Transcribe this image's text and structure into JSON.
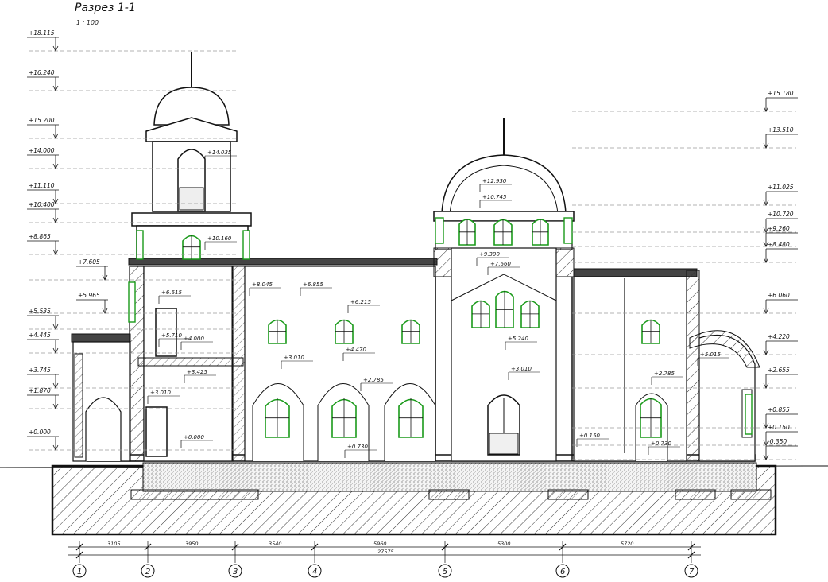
{
  "title": "Разрез 1-1",
  "scale": "1 : 100",
  "left_levels": [
    "+18.115",
    "+16.240",
    "+15.200",
    "+14.000",
    "+11.110",
    "+10.400",
    "+8.865",
    "+7.605",
    "+5.965",
    "+5.535",
    "+4.445",
    "+3.745",
    "+1.870",
    "+0.000"
  ],
  "right_levels": [
    "+15.180",
    "+13.510",
    "+11.025",
    "+10.720",
    "+9.260",
    "+8.480",
    "+6.060",
    "+4.220",
    "+2.655",
    "+0.855",
    "+0.150",
    "-0.350"
  ],
  "inner_marks": [
    "+14.035",
    "+12.930",
    "+10.745",
    "+10.160",
    "+9.390",
    "+8.045",
    "+7.660",
    "+6.855",
    "+6.615",
    "+6.215",
    "+5.710",
    "+5.240",
    "+5.015",
    "+4.470",
    "+4.000",
    "+3.425",
    "+3.010",
    "+3.010",
    "+3.010",
    "+2.785",
    "+2.785",
    "+0.730",
    "+0.730",
    "+0.150",
    "+0.000"
  ],
  "dimensions": [
    "3105",
    "3950",
    "3540",
    "5960",
    "5300",
    "5720"
  ],
  "total_dimension": "27575",
  "axes": [
    "1",
    "2",
    "3",
    "4",
    "5",
    "6",
    "7"
  ],
  "colors": {
    "line": "#111111",
    "window": "#1a9a1a",
    "hatch": "#333333",
    "leader": "#9a9a9a"
  }
}
